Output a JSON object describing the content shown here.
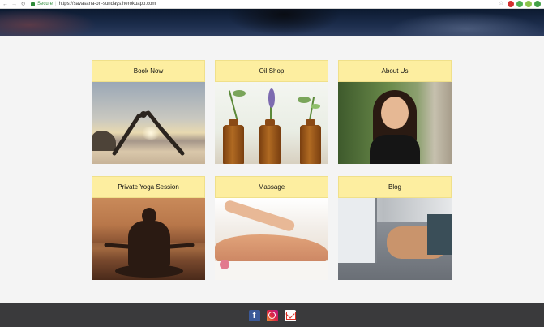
{
  "browser": {
    "secure_label": "Secure",
    "url": "https://savasana-on-sundays.herokuapp.com"
  },
  "tiles": [
    {
      "label": "Book Now",
      "image": "yoga-on-beach"
    },
    {
      "label": "Oil Shop",
      "image": "essential-oil-bottles"
    },
    {
      "label": "About Us",
      "image": "smiling-instructor-portrait"
    },
    {
      "label": "Private Yoga Session",
      "image": "meditation-silhouette"
    },
    {
      "label": "Massage",
      "image": "back-massage"
    },
    {
      "label": "Blog",
      "image": "typing-on-laptop"
    }
  ],
  "footer": {
    "icons": [
      "facebook-icon",
      "instagram-icon",
      "gmail-icon"
    ],
    "facebook_glyph": "f"
  },
  "colors": {
    "tile_header": "#fdeea0",
    "footer_bg": "#3a3a3c",
    "page_bg": "#f4f4f4"
  }
}
